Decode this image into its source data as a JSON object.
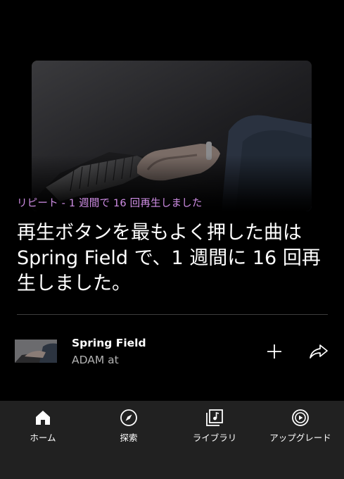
{
  "recap": {
    "subtitle": "リピート - 1 週間で 16 回再生しました",
    "headline": "再生ボタンを最もよく押した曲は Spring Field で、1 週間に 16 回再生しました。"
  },
  "track": {
    "title": "Spring Field",
    "artist": "ADAM at",
    "add_icon": "plus-icon",
    "share_icon": "share-arrow-icon"
  },
  "nav": {
    "items": [
      {
        "label": "ホーム",
        "icon": "home-icon",
        "active": true
      },
      {
        "label": "探索",
        "icon": "compass-icon",
        "active": false
      },
      {
        "label": "ライブラリ",
        "icon": "library-icon",
        "active": false
      },
      {
        "label": "アップグレード",
        "icon": "upgrade-icon",
        "active": false
      }
    ]
  },
  "colors": {
    "background": "#000000",
    "accent_subtitle": "#d08ee6",
    "nav_background": "#212121",
    "secondary_text": "#b3b3b3"
  }
}
